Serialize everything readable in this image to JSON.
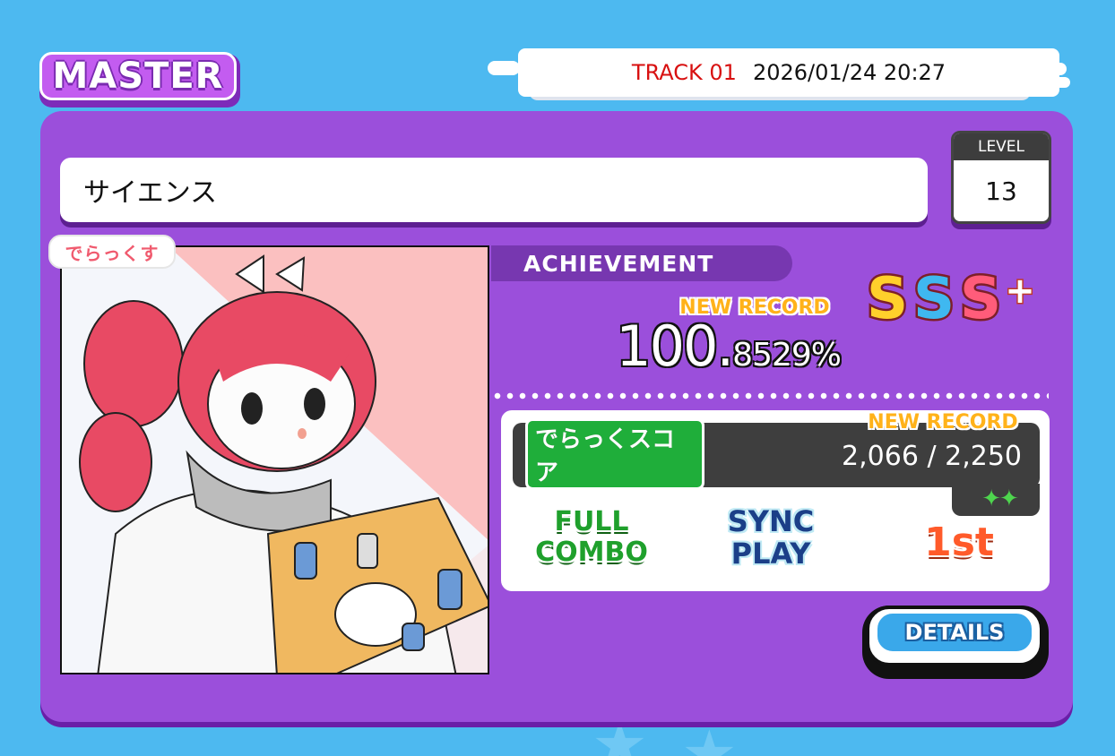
{
  "difficulty": "MASTER",
  "header": {
    "track": "TRACK 01",
    "datetime": "2026/01/24 20:27"
  },
  "song": {
    "title": "サイエンス"
  },
  "level": {
    "label": "LEVEL",
    "value": "13"
  },
  "source_badge": "でらっくす",
  "achievement": {
    "label": "ACHIEVEMENT",
    "new_record": "NEW RECORD",
    "score_int": "100.",
    "score_dec": "8529%",
    "rank": {
      "c1": "S",
      "c2": "S",
      "c3": "S",
      "plus": "+"
    }
  },
  "dx_score": {
    "label": "でらっくスコア",
    "new_record": "NEW RECORD",
    "value": "2,066 / 2,250",
    "stars": "✦✦"
  },
  "badges": {
    "combo_line1": "FULL",
    "combo_line2": "COMBO",
    "sync_line1": "SYNC",
    "sync_line2": "PLAY",
    "place": "1st"
  },
  "details_button": "DETAILS",
  "colors": {
    "background": "#4db9f0",
    "panel": "#9b4fdb",
    "accent_red": "#d81010"
  }
}
